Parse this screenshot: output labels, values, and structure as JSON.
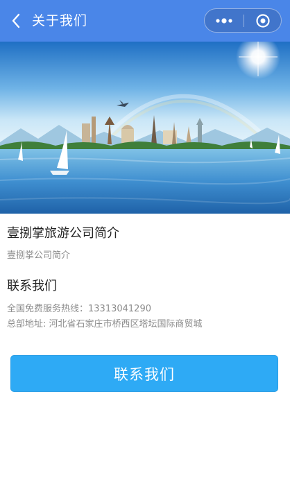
{
  "header": {
    "title": "关于我们",
    "back_icon": "chevron-left-icon",
    "more_icon": "more-dots-icon",
    "close_icon": "target-circle-icon"
  },
  "banner": {
    "description_icon": "travel-landmarks-banner"
  },
  "company": {
    "title": "壹捌掌旅游公司简介",
    "subtitle": "壹捌掌公司简介"
  },
  "contact": {
    "heading": "联系我们",
    "hotline": "全国免费服务热线：13313041290",
    "address": "总部地址: 河北省石家庄市桥西区塔坛国际商贸城",
    "button_label": "联系我们"
  },
  "colors": {
    "navbar": "#4a86e8",
    "button": "#2eaaf5",
    "text_primary": "#222222",
    "text_secondary": "#8c8c8c"
  }
}
